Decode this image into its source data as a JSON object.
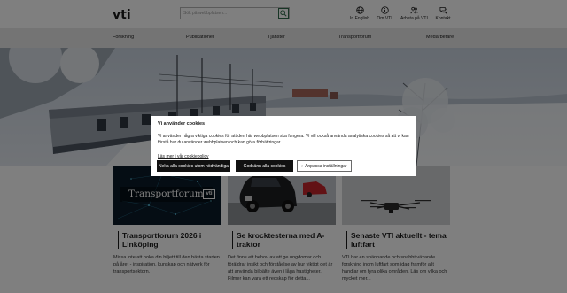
{
  "header": {
    "logo": "vti",
    "search": {
      "placeholder": "Sök på webbplatsen..."
    },
    "utilities": [
      {
        "label": "In English",
        "icon": "globe-icon"
      },
      {
        "label": "Om VTI",
        "icon": "info-icon"
      },
      {
        "label": "Arbeta på VTI",
        "icon": "people-icon"
      },
      {
        "label": "Kontakt",
        "icon": "chat-icon"
      }
    ]
  },
  "nav": {
    "items": [
      "Forskning",
      "Publikationer",
      "Tjänster",
      "Transportforum",
      "Medarbetare"
    ]
  },
  "cards": [
    {
      "image_text": "Transportforum",
      "image_badge": "vti",
      "title": "Transportforum 2026 i Linköping",
      "description": "Missa inte att boka din biljett till den bästa starten på året - inspiration, kunskap och nätverk för transportsektorn."
    },
    {
      "title": "Se krocktesterna med A-traktor",
      "description": "Det finns ett behov av att ge ungdomar och föräldrar insikt och förståelse av hur viktigt det är att använda bilbälte även i låga hastigheter. Filmer kan vara ett redskap för detta..."
    },
    {
      "image_text": "aktuellt",
      "title": "Senaste VTI aktuellt - tema luftfart",
      "description": "VTI har en spännande och snabbt växande forskning inom luftfart som idag framför allt handlar om fyra olika områden. Läs om vilka och mycket mer..."
    }
  ],
  "cookie_dialog": {
    "title": "Vi använder cookies",
    "text": "Vi använder några viktiga cookies för att den här webbplatsen ska fungera. Vi vill också använda analytiska cookies så att vi kan förstå hur du använder webbplatsen och kan göra förbättringar.",
    "policy_link": "Läs mer i vår cookiepolicy",
    "buttons": {
      "reject": "Neka alla cookies utom nödvändiga",
      "accept": "Godkänn alla cookies",
      "settings": "Anpassa inställningar"
    }
  },
  "colors": {
    "accent_green": "#2e6b4a",
    "nav_bg": "#e9e9e9",
    "button_dark": "#111111"
  }
}
